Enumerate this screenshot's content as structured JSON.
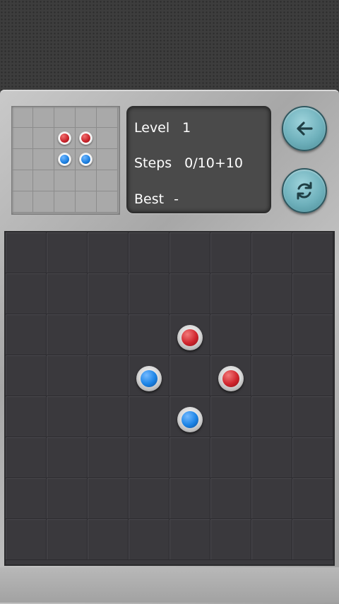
{
  "info": {
    "level_label": "Level",
    "level_value": "1",
    "steps_label": "Steps",
    "steps_value": "0/10+10",
    "best_label": "Best",
    "best_value": "-"
  },
  "buttons": {
    "back_icon": "arrow-left-icon",
    "reset_icon": "refresh-icon"
  },
  "colors": {
    "red_piece": "#d0262e",
    "blue_piece": "#1c84e6",
    "button_accent": "#6fb1bc",
    "board": "#3a393d"
  },
  "preview": {
    "grid_size": 5,
    "pieces": [
      {
        "row": 1,
        "col": 2,
        "color": "red"
      },
      {
        "row": 1,
        "col": 3,
        "color": "red"
      },
      {
        "row": 2,
        "col": 2,
        "color": "blue"
      },
      {
        "row": 2,
        "col": 3,
        "color": "blue"
      }
    ]
  },
  "board": {
    "grid_size": 8,
    "pieces": [
      {
        "row": 2,
        "col": 4,
        "color": "red"
      },
      {
        "row": 3,
        "col": 3,
        "color": "blue"
      },
      {
        "row": 3,
        "col": 5,
        "color": "red"
      },
      {
        "row": 4,
        "col": 4,
        "color": "blue"
      }
    ]
  }
}
